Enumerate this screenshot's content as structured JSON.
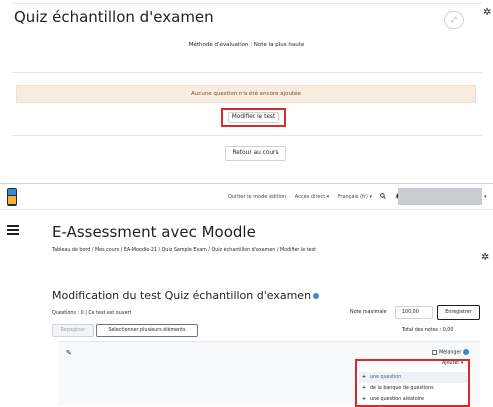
{
  "top": {
    "quiz_title": "Quiz échantillon d'examen",
    "grading_method": "Méthode d'évaluation : Note la plus haute",
    "no_questions_notice": "Aucune question n'a été encore ajoutée",
    "edit_quiz_button": "Modifier le test",
    "back_to_course_button": "Retour au cours",
    "expand_icon_glyph": "⤢",
    "gear_icon_glyph": "✲"
  },
  "navbar": {
    "items": [
      "Quitter le mode édition",
      "Accès direct ▾",
      "Français (fr) ▾"
    ],
    "search_icon": "search-icon",
    "bell_icon": "bell-icon",
    "chat_icon": "chat-icon"
  },
  "page": {
    "course_title": "E-Assessment avec Moodle",
    "breadcrumb": "Tableau de bord  /  Mes cours  /  EA-Moodle-21  /  Quiz Sample Exam  /  Quiz échantillon d'examen  /  Modifier le test",
    "edit_title": "Modification du test Quiz échantillon d'examen",
    "questions_status": "Questions : 0 | Ce test est ouvert",
    "max_grade_label": "Note maximale",
    "max_grade_value": "100,00",
    "save_button": "Enregistrer",
    "repaginate_button": "Repaginer",
    "select_multiple_button": "Sélectionner plusieurs éléments",
    "total_grades": "Total des notes : 0,00",
    "shuffle_label": "Mélanger",
    "add_toggle": "Ajouter ▾",
    "add_menu": [
      "une question",
      "de la banque de questions",
      "une question aléatoire"
    ]
  },
  "colors": {
    "highlight_red": "#d9292b",
    "alert_bg": "#f7ecdf",
    "info_blue": "#3b87d1"
  }
}
